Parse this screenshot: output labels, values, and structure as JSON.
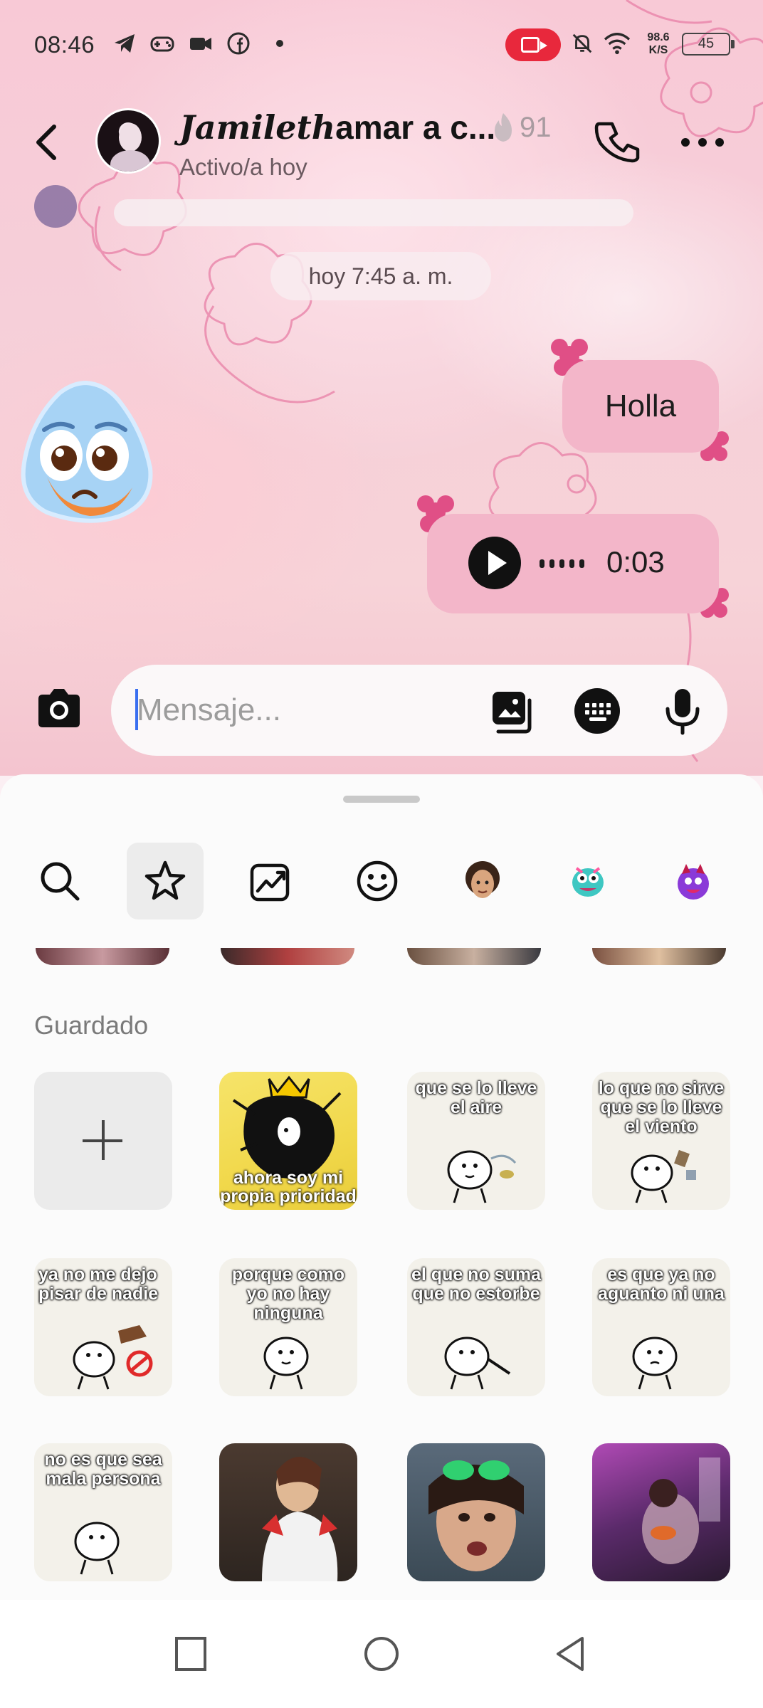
{
  "status_bar": {
    "time": "08:46",
    "speed_value": "98.6",
    "speed_unit": "K/S",
    "battery": "45",
    "icons": [
      "telegram-icon",
      "gamepad-icon",
      "video-icon",
      "facebook-icon",
      "dot-icon",
      "screen-record-icon",
      "mute-icon",
      "wifi-icon",
      "battery-icon"
    ]
  },
  "header": {
    "contact_name_styled": "Jamileth",
    "contact_name_rest": "amar a c...",
    "status": "Activo/a hoy",
    "streak_count": "91"
  },
  "messages": {
    "date_chip": "hoy 7:45 a. m.",
    "text_message": "Holla",
    "audio_duration": "0:03"
  },
  "composer": {
    "placeholder": "Mensaje..."
  },
  "sticker_tray": {
    "tabs": [
      "search-tab",
      "favorites-tab",
      "trending-tab",
      "emoji-tab",
      "avatar-tab",
      "character-tab",
      "purple-character-tab"
    ],
    "active_tab": "favorites-tab",
    "section_title": "Guardado",
    "stickers": [
      {
        "kind": "add"
      },
      {
        "kind": "crown",
        "caption": "ahora soy mi propia prioridad"
      },
      {
        "kind": "meme",
        "caption": "que se lo lleve el aire"
      },
      {
        "kind": "meme",
        "caption": "lo que no sirve que se lo lleve el viento"
      },
      {
        "kind": "meme",
        "caption": "ya no me dejo pisar de nadie"
      },
      {
        "kind": "meme",
        "caption": "porque como yo no hay ninguna"
      },
      {
        "kind": "meme",
        "caption": "el que no suma que no estorbe"
      },
      {
        "kind": "meme",
        "caption": "es que ya no aguanto ni una"
      },
      {
        "kind": "meme",
        "caption": "no es que sea mala persona"
      },
      {
        "kind": "photo"
      },
      {
        "kind": "photo"
      },
      {
        "kind": "photo"
      }
    ]
  },
  "colors": {
    "bubble": "#f3b6c9",
    "accent_caret": "#3a6ff0",
    "record_pill": "#e8283c"
  }
}
